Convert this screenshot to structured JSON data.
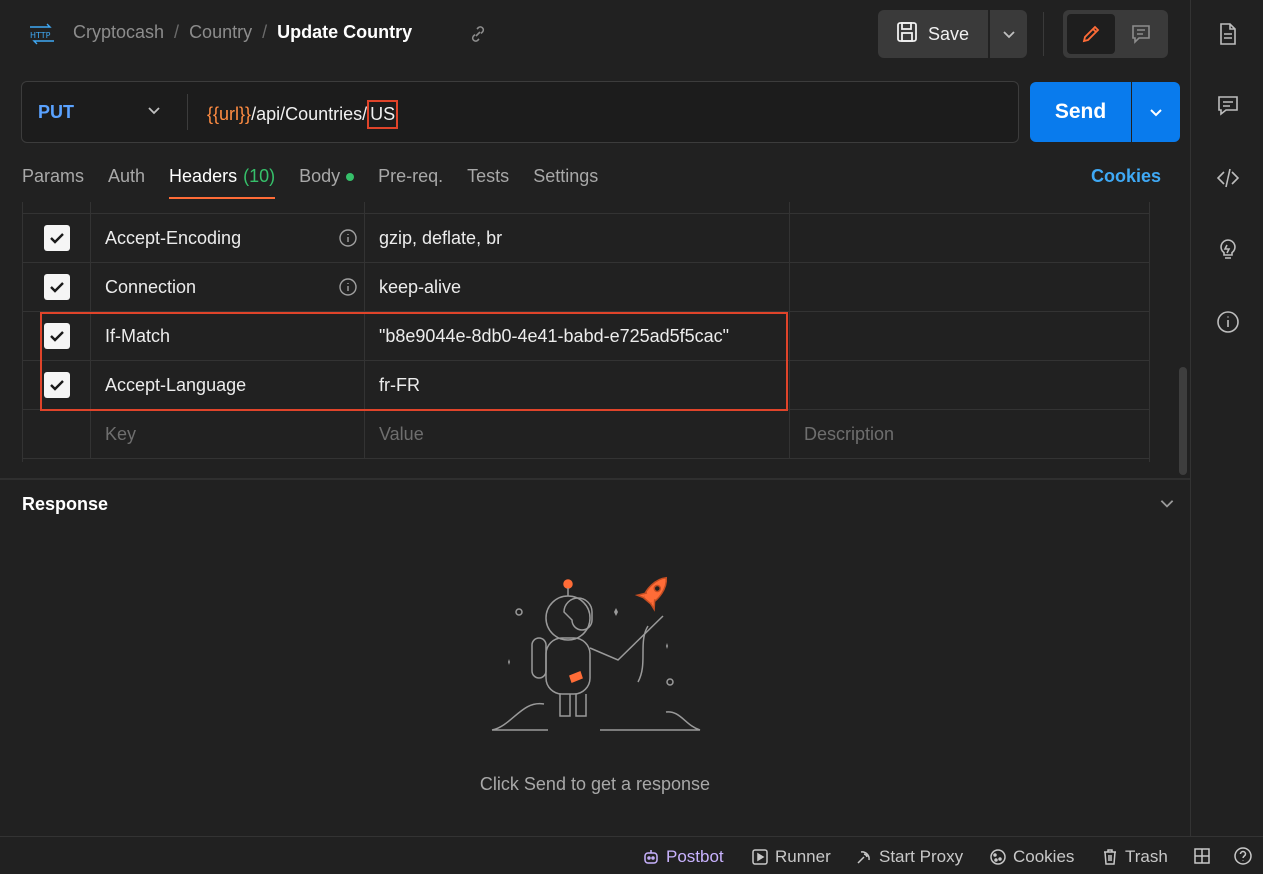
{
  "breadcrumb": {
    "workspace": "Cryptocash",
    "folder": "Country",
    "request": "Update Country",
    "separator": "/"
  },
  "toolbar": {
    "save_label": "Save"
  },
  "request": {
    "method": "PUT",
    "url_variable": "{{url}}",
    "url_path": "/api/Countries/",
    "url_param": "US",
    "send_label": "Send"
  },
  "tabs": [
    {
      "label": "Params"
    },
    {
      "label": "Auth"
    },
    {
      "label": "Headers",
      "count": "(10)"
    },
    {
      "label": "Body"
    },
    {
      "label": "Pre-req."
    },
    {
      "label": "Tests"
    },
    {
      "label": "Settings"
    }
  ],
  "cookies_label": "Cookies",
  "headers": [
    {
      "key": "Accept-Encoding",
      "value": "gzip, deflate, br",
      "checked": true
    },
    {
      "key": "Connection",
      "value": "keep-alive",
      "checked": true
    },
    {
      "key": "If-Match",
      "value": "\"b8e9044e-8db0-4e41-babd-e725ad5f5cac\"",
      "checked": true
    },
    {
      "key": "Accept-Language",
      "value": "fr-FR",
      "checked": true
    }
  ],
  "header_placeholders": {
    "key": "Key",
    "value": "Value",
    "description": "Description"
  },
  "response": {
    "title": "Response",
    "empty_message": "Click Send to get a response"
  },
  "statusbar": {
    "postbot": "Postbot",
    "runner": "Runner",
    "start_proxy": "Start Proxy",
    "cookies": "Cookies",
    "trash": "Trash"
  },
  "colors": {
    "accent": "#ff6c37",
    "send": "#097bed",
    "link": "#3fa9f5",
    "highlight": "#e0442a",
    "success": "#36c06a"
  }
}
